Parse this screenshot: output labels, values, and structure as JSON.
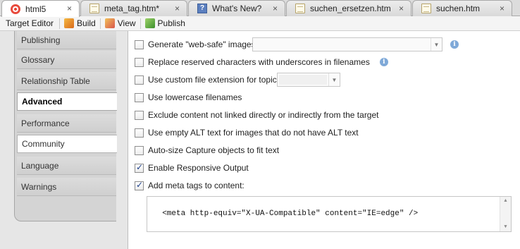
{
  "tabs": [
    {
      "label": "html5",
      "icon": "target-icon"
    },
    {
      "label": "meta_tag.htm*",
      "icon": "document-icon"
    },
    {
      "label": "What's New?",
      "icon": "help-icon"
    },
    {
      "label": "suchen_ersetzen.htm",
      "icon": "document-icon"
    },
    {
      "label": "suchen.htm",
      "icon": "document-icon"
    }
  ],
  "toolbar": {
    "title": "Target Editor",
    "build_label": "Build",
    "view_label": "View",
    "publish_label": "Publish"
  },
  "nav": {
    "items": [
      {
        "label": "Publishing"
      },
      {
        "label": "Glossary"
      },
      {
        "label": "Relationship Table"
      },
      {
        "label": "Advanced"
      },
      {
        "label": "Performance"
      },
      {
        "label": "Community"
      },
      {
        "label": "Language"
      },
      {
        "label": "Warnings"
      }
    ],
    "selected": "Advanced"
  },
  "options": {
    "generate_web_safe": {
      "label": "Generate \"web-safe\" images",
      "checked": false
    },
    "replace_reserved": {
      "label": "Replace reserved characters with underscores in filenames",
      "checked": false
    },
    "custom_extension": {
      "label": "Use custom file extension for topics",
      "checked": false
    },
    "lowercase_filenames": {
      "label": "Use lowercase filenames",
      "checked": false
    },
    "exclude_unlinked": {
      "label": "Exclude content not linked directly or indirectly from the target",
      "checked": false
    },
    "empty_alt": {
      "label": "Use empty ALT text for images that do not have ALT text",
      "checked": false
    },
    "autosize_capture": {
      "label": "Auto-size Capture objects to fit text",
      "checked": false
    },
    "responsive_output": {
      "label": "Enable Responsive Output",
      "checked": true
    },
    "meta_tags": {
      "label": "Add meta tags to content:",
      "checked": true
    }
  },
  "meta_tags_value": "<meta http-equiv=\"X-UA-Compatible\" content=\"IE=edge\" />",
  "icons": {
    "close": "×",
    "info": "i",
    "dropdown": "▼"
  }
}
